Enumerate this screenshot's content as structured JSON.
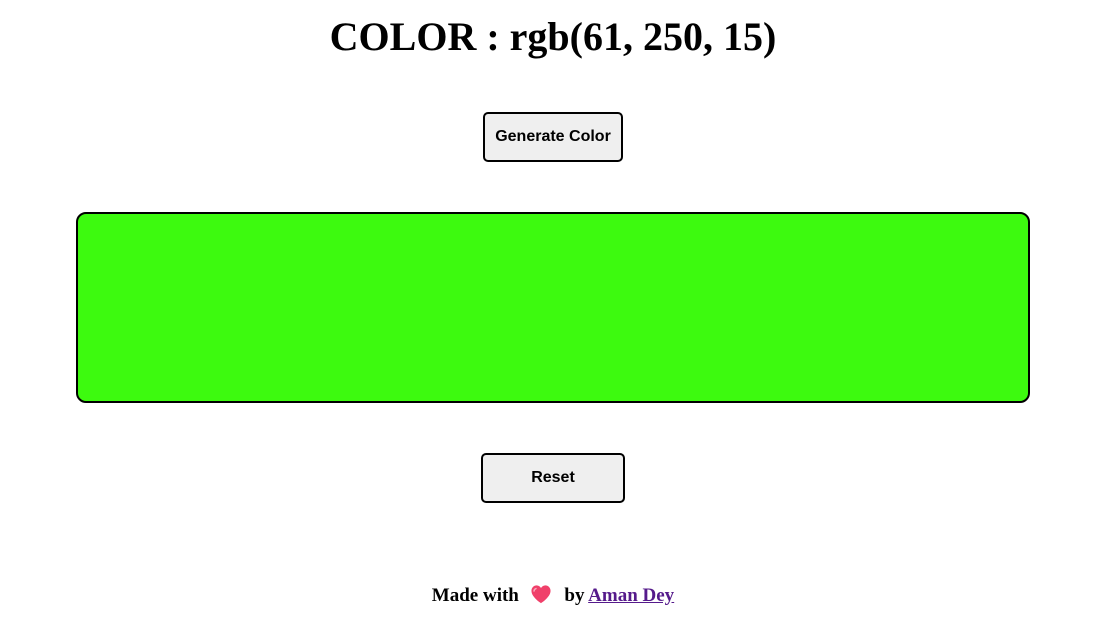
{
  "title": "COLOR : rgb(61, 250, 15)",
  "generate_button_label": "Generate Color",
  "swatch": {
    "color": "#3dfa0f"
  },
  "reset_button_label": "Reset",
  "footer": {
    "made_with": "Made with",
    "heart_icon": "heart-icon",
    "heart_color": "#f0406a",
    "by": "by",
    "author_link": "Aman Dey",
    "link_color": "#551a8b"
  }
}
